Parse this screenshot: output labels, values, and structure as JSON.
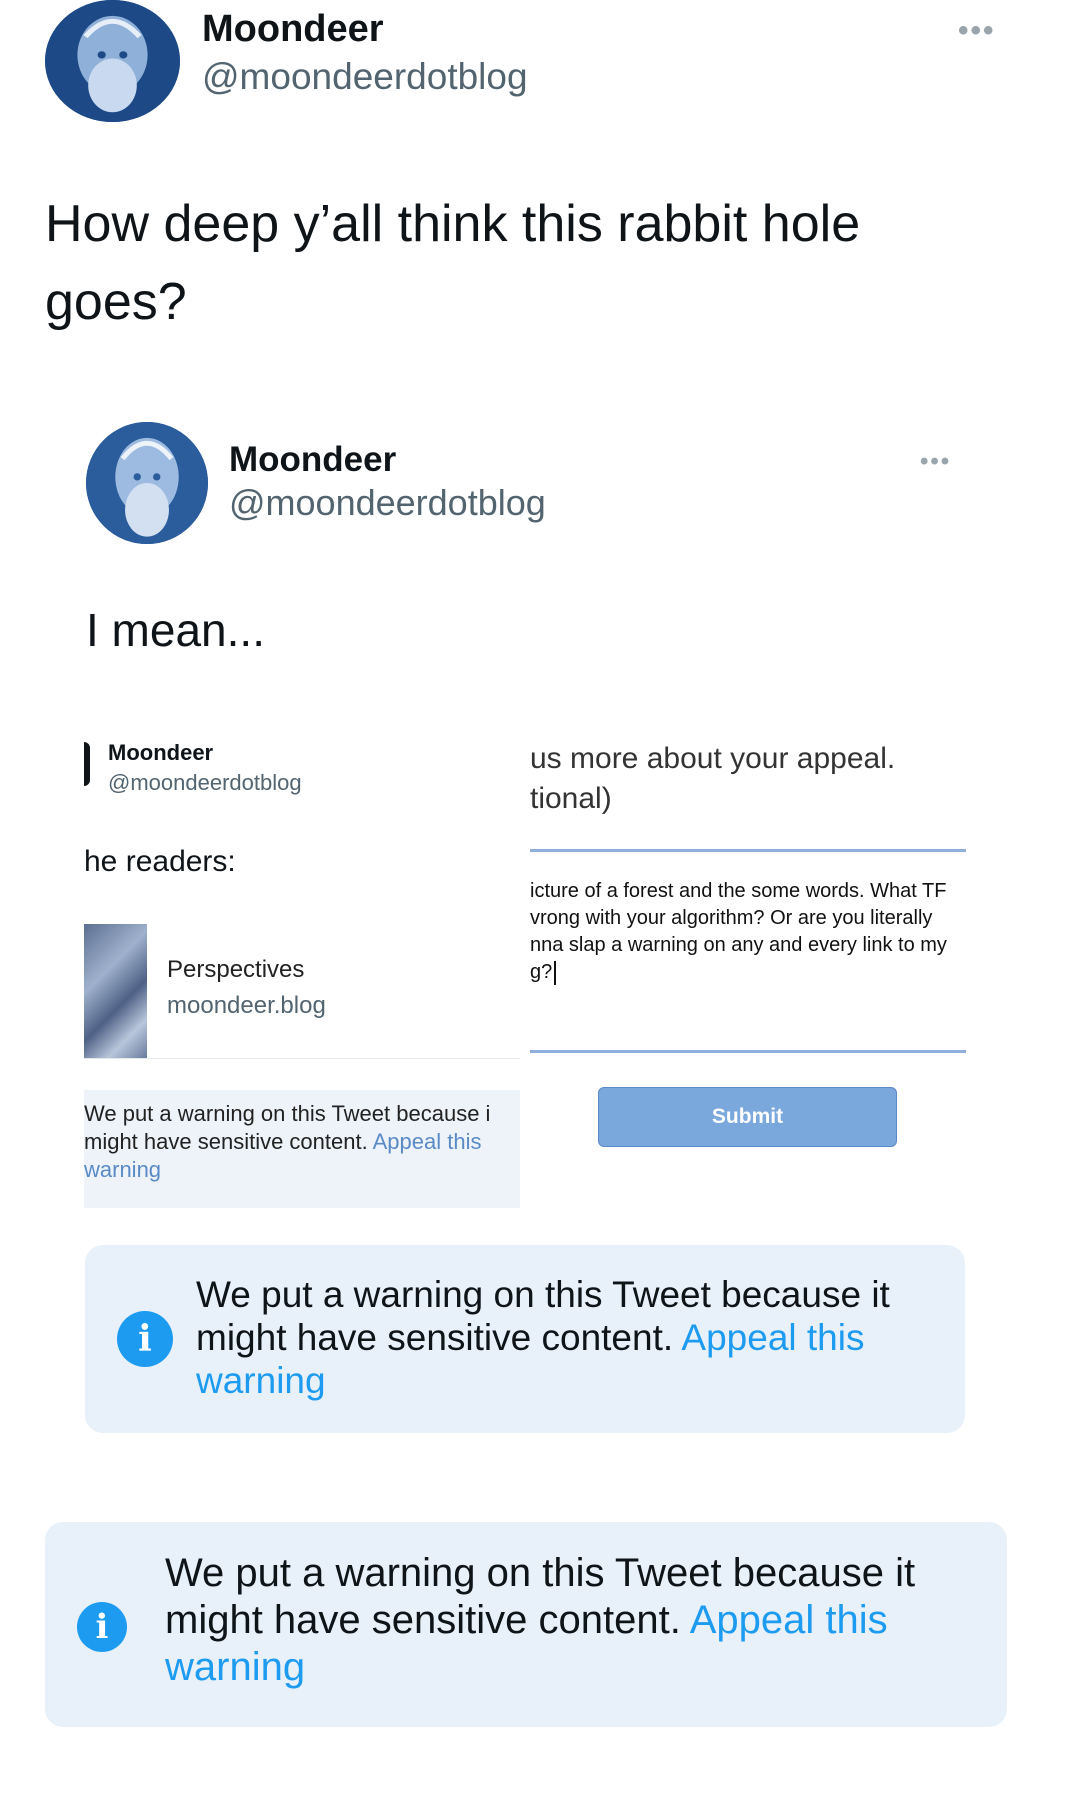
{
  "outer_tweet": {
    "name": "Moondeer",
    "handle": "@moondeerdotblog",
    "text": "How deep y’all think this rabbit hole goes?",
    "more_icon": "more-horizontal-icon"
  },
  "inner_tweet": {
    "name": "Moondeer",
    "handle": "@moondeerdotblog",
    "text": "I mean...",
    "more_icon": "more-horizontal-icon"
  },
  "screenshot": {
    "name": "Moondeer",
    "handle": "@moondeerdotblog",
    "readers": "he readers:",
    "card_title": "Perspectives",
    "card_domain": "moondeer.blog",
    "warning_line1": "We put a warning on this Tweet because i",
    "warning_line2": "might have sensitive content.",
    "warning_link1": "Appeal this",
    "warning_link2": "warning",
    "appeal_line1": "us more about your appeal.",
    "appeal_line2": "tional)",
    "appeal_text1": "icture of a forest and the some words. What TF",
    "appeal_text2": "vrong with your algorithm? Or are you literally",
    "appeal_text3": "nna slap a warning on any and every link to my",
    "appeal_text4": "g?",
    "submit_label": "Submit"
  },
  "inner_warning": {
    "line1": "We put a warning on this Tweet because it",
    "line2": "might have sensitive content.",
    "link1": "Appeal this",
    "link2": "warning"
  },
  "outer_warning": {
    "line1": "We put a warning on this Tweet because it",
    "line2": "might have sensitive content.",
    "link1": "Appeal this",
    "link2": "warning"
  },
  "colors": {
    "link": "#1d9bf0",
    "warning_bg": "#e8f1fa",
    "submit_bg": "#7aa7dc"
  }
}
